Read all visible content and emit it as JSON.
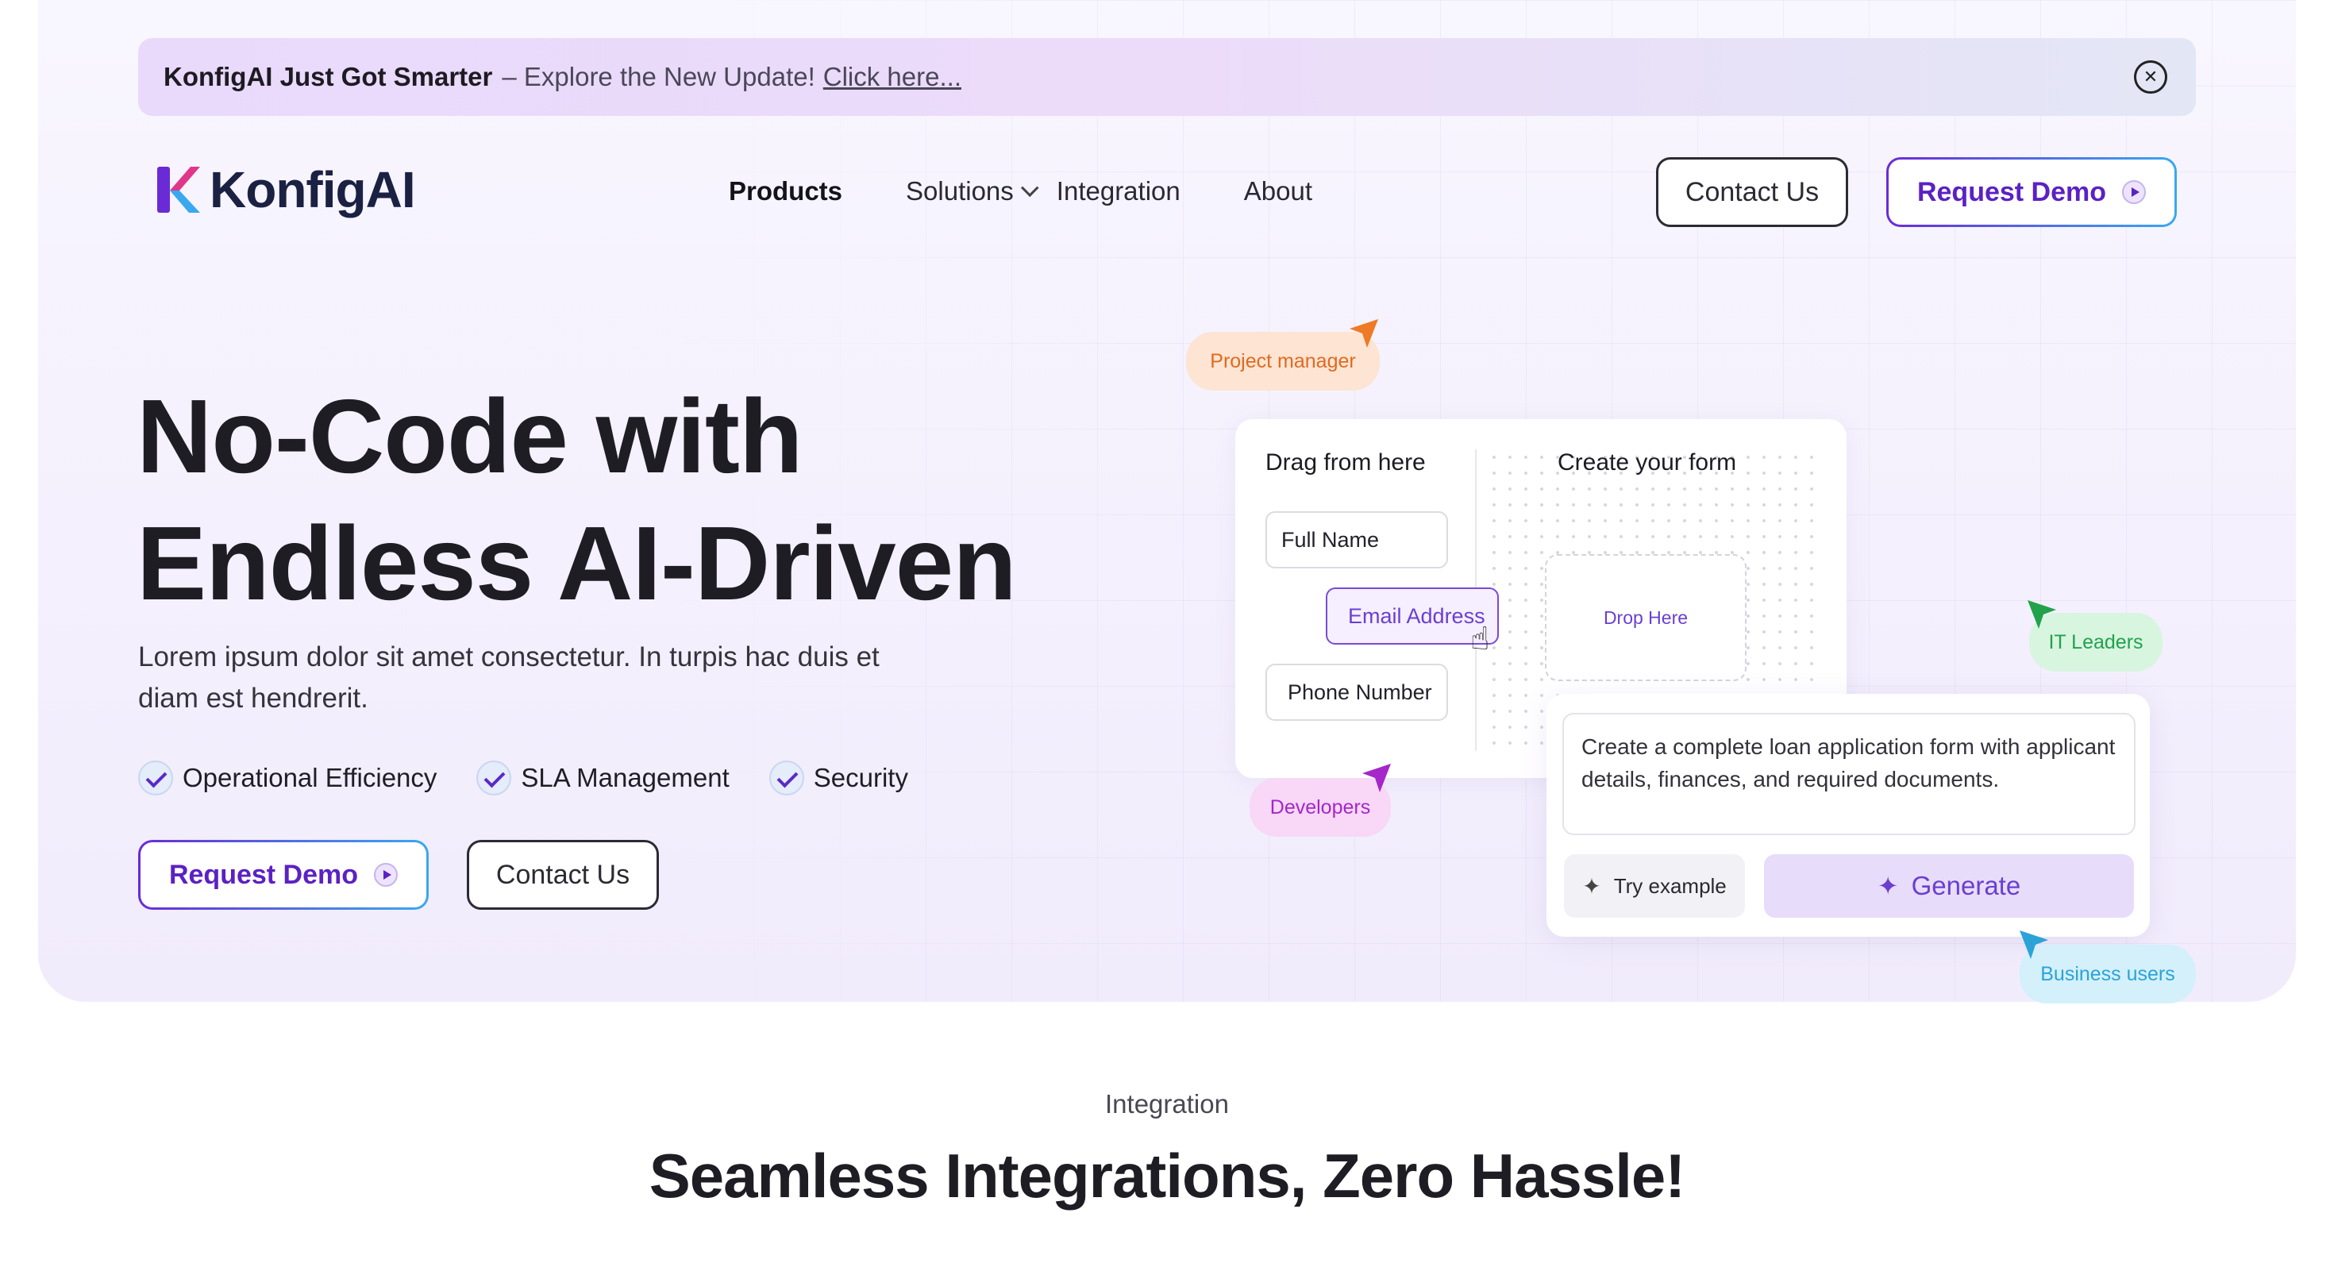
{
  "announcement": {
    "lead": "KonfigAI Just Got Smarter",
    "rest": "– Explore the New Update!",
    "link": "Click here..."
  },
  "brand": {
    "name": "KonfigAI"
  },
  "nav": {
    "items": [
      {
        "label": "Products"
      },
      {
        "label": "Solutions"
      },
      {
        "label": "Integration"
      },
      {
        "label": "About"
      }
    ],
    "contact_label": "Contact Us",
    "demo_label": "Request Demo"
  },
  "hero": {
    "title_line1": "No-Code with",
    "title_line2": "Endless AI-Driven",
    "subtitle": "Lorem ipsum dolor sit amet consectetur. In turpis hac duis et diam est hendrerit.",
    "features": [
      "Operational Efficiency",
      "SLA Management",
      "Security"
    ],
    "demo_label": "Request Demo",
    "contact_label": "Contact Us"
  },
  "builder": {
    "drag_title": "Drag from here",
    "create_title": "Create your form",
    "fields": [
      "Full Name",
      "Email Address",
      "Phone Number"
    ],
    "drop_label": "Drop Here",
    "prompt": "Create a complete loan application form with applicant details, finances, and required documents.",
    "try_label": "Try example",
    "generate_label": "Generate",
    "tags": {
      "pm": "Project manager",
      "dev": "Developers",
      "it": "IT Leaders",
      "business": "Business users"
    }
  },
  "integration": {
    "label": "Integration",
    "title": "Seamless Integrations, Zero Hassle!"
  },
  "colors": {
    "brand_purple": "#5b21c4",
    "orange": "#e06a1f",
    "magenta": "#a527c9",
    "green": "#22a24b",
    "cyan": "#2ba3d7"
  }
}
